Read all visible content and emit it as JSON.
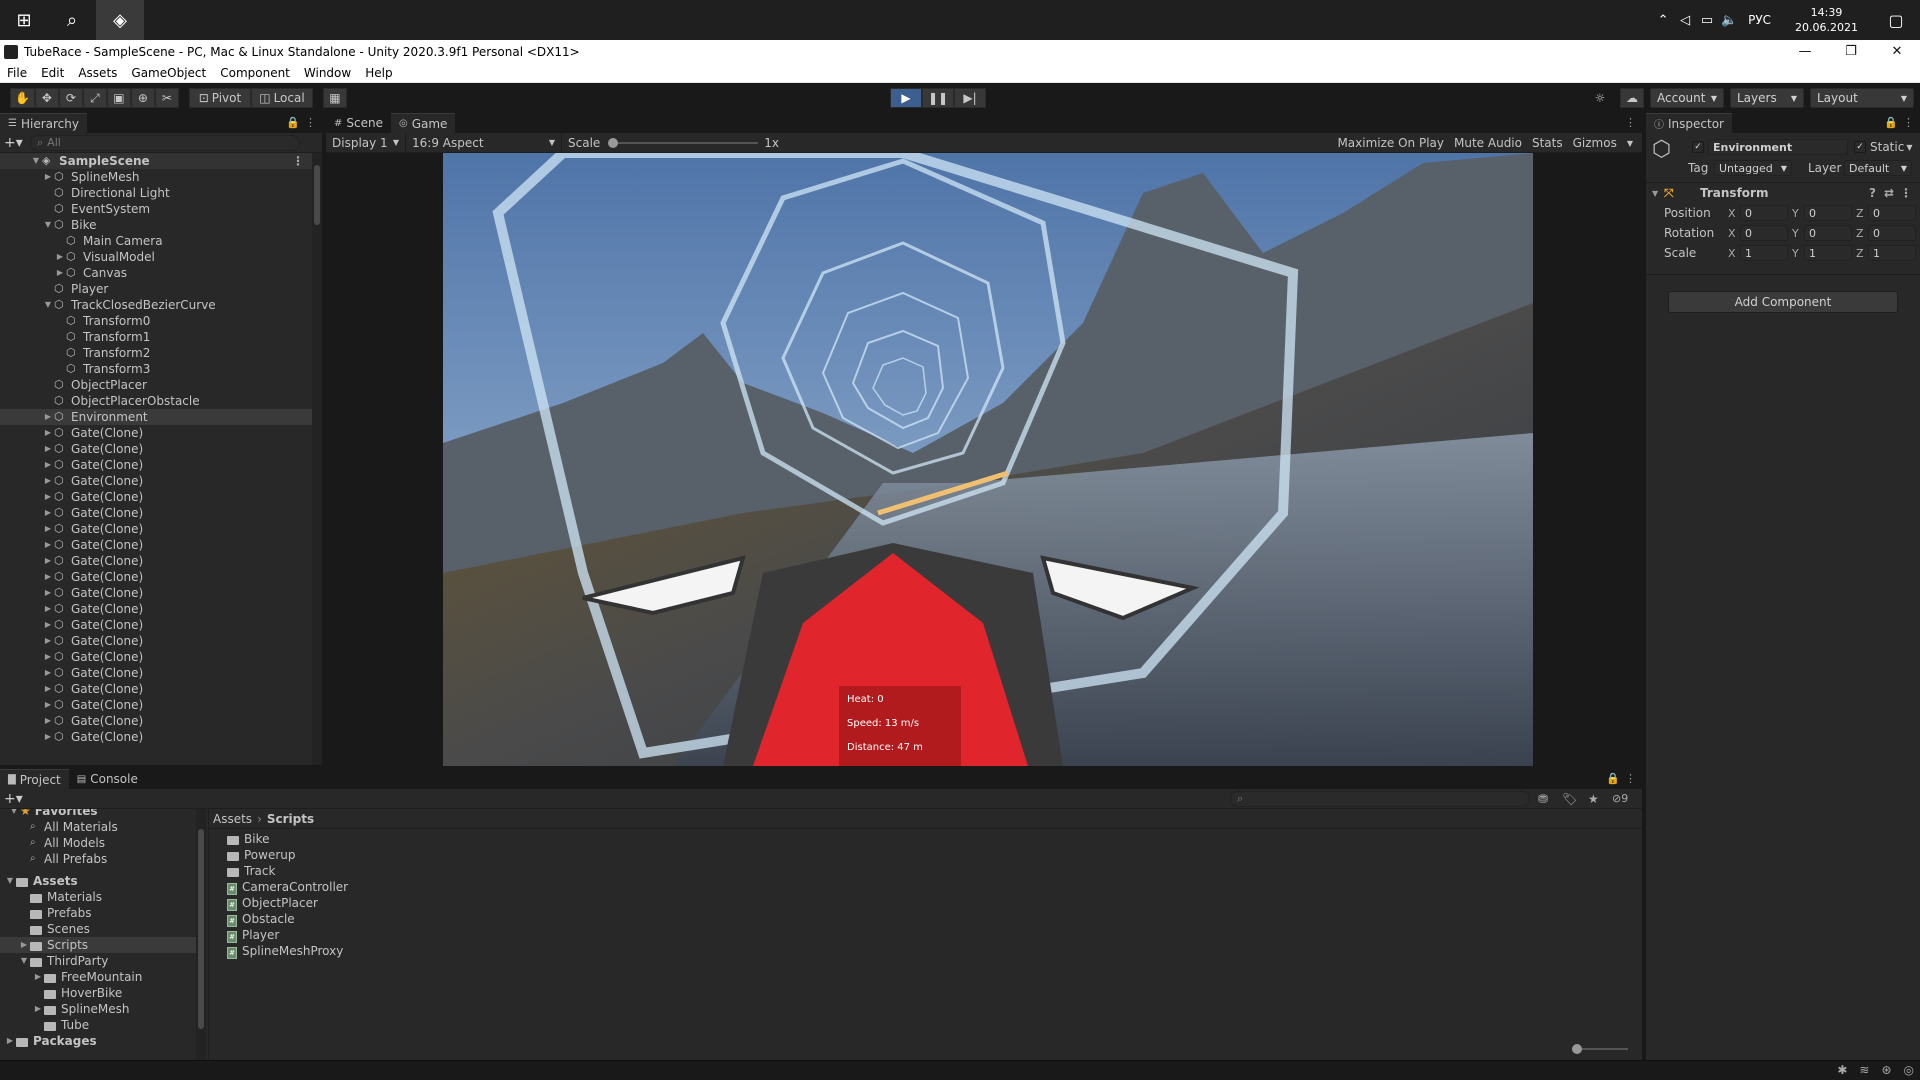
{
  "taskbar": {
    "tray": {
      "lang": "РУС",
      "time": "14:39",
      "date": "20.06.2021"
    }
  },
  "window": {
    "title": "TubeRace - SampleScene - PC, Mac & Linux Standalone - Unity 2020.3.9f1 Personal <DX11>"
  },
  "menu": [
    "File",
    "Edit",
    "Assets",
    "GameObject",
    "Component",
    "Window",
    "Help"
  ],
  "toolbar": {
    "pivot": "Pivot",
    "local": "Local",
    "account": "Account",
    "layers": "Layers",
    "layout": "Layout"
  },
  "hierarchy": {
    "tab": "Hierarchy",
    "search_placeholder": "All",
    "scene": "SampleScene",
    "items": [
      {
        "label": "SplineMesh",
        "depth": 1,
        "arrow": "▶"
      },
      {
        "label": "Directional Light",
        "depth": 1,
        "arrow": ""
      },
      {
        "label": "EventSystem",
        "depth": 1,
        "arrow": ""
      },
      {
        "label": "Bike",
        "depth": 1,
        "arrow": "▼"
      },
      {
        "label": "Main Camera",
        "depth": 2,
        "arrow": ""
      },
      {
        "label": "VisualModel",
        "depth": 2,
        "arrow": "▶"
      },
      {
        "label": "Canvas",
        "depth": 2,
        "arrow": "▶"
      },
      {
        "label": "Player",
        "depth": 1,
        "arrow": ""
      },
      {
        "label": "TrackClosedBezierCurve",
        "depth": 1,
        "arrow": "▼"
      },
      {
        "label": "Transform0",
        "depth": 2,
        "arrow": ""
      },
      {
        "label": "Transform1",
        "depth": 2,
        "arrow": ""
      },
      {
        "label": "Transform2",
        "depth": 2,
        "arrow": ""
      },
      {
        "label": "Transform3",
        "depth": 2,
        "arrow": ""
      },
      {
        "label": "ObjectPlacer",
        "depth": 1,
        "arrow": ""
      },
      {
        "label": "ObjectPlacerObstacle",
        "depth": 1,
        "arrow": ""
      },
      {
        "label": "Environment",
        "depth": 1,
        "arrow": "▶",
        "selected": true
      },
      {
        "label": "Gate(Clone)",
        "depth": 1,
        "arrow": "▶"
      },
      {
        "label": "Gate(Clone)",
        "depth": 1,
        "arrow": "▶"
      },
      {
        "label": "Gate(Clone)",
        "depth": 1,
        "arrow": "▶"
      },
      {
        "label": "Gate(Clone)",
        "depth": 1,
        "arrow": "▶"
      },
      {
        "label": "Gate(Clone)",
        "depth": 1,
        "arrow": "▶"
      },
      {
        "label": "Gate(Clone)",
        "depth": 1,
        "arrow": "▶"
      },
      {
        "label": "Gate(Clone)",
        "depth": 1,
        "arrow": "▶"
      },
      {
        "label": "Gate(Clone)",
        "depth": 1,
        "arrow": "▶"
      },
      {
        "label": "Gate(Clone)",
        "depth": 1,
        "arrow": "▶"
      },
      {
        "label": "Gate(Clone)",
        "depth": 1,
        "arrow": "▶"
      },
      {
        "label": "Gate(Clone)",
        "depth": 1,
        "arrow": "▶"
      },
      {
        "label": "Gate(Clone)",
        "depth": 1,
        "arrow": "▶"
      },
      {
        "label": "Gate(Clone)",
        "depth": 1,
        "arrow": "▶"
      },
      {
        "label": "Gate(Clone)",
        "depth": 1,
        "arrow": "▶"
      },
      {
        "label": "Gate(Clone)",
        "depth": 1,
        "arrow": "▶"
      },
      {
        "label": "Gate(Clone)",
        "depth": 1,
        "arrow": "▶"
      },
      {
        "label": "Gate(Clone)",
        "depth": 1,
        "arrow": "▶"
      },
      {
        "label": "Gate(Clone)",
        "depth": 1,
        "arrow": "▶"
      },
      {
        "label": "Gate(Clone)",
        "depth": 1,
        "arrow": "▶"
      },
      {
        "label": "Gate(Clone)",
        "depth": 1,
        "arrow": "▶"
      }
    ]
  },
  "game": {
    "tabs": [
      "Scene",
      "Game"
    ],
    "display": "Display 1",
    "aspect": "16:9 Aspect",
    "scale_label": "Scale",
    "scale_value": "1x",
    "maximize": "Maximize On Play",
    "mute": "Mute Audio",
    "stats": "Stats",
    "gizmos": "Gizmos",
    "hud": {
      "heat": "Heat: 0",
      "speed": "Speed: 13 m/s",
      "distance": "Distance: 47 m"
    }
  },
  "inspector": {
    "tab": "Inspector",
    "object_name": "Environment",
    "static": "Static",
    "tag_label": "Tag",
    "tag_value": "Untagged",
    "layer_label": "Layer",
    "layer_value": "Default",
    "component": "Transform",
    "rows": [
      {
        "label": "Position",
        "x": "0",
        "y": "0",
        "z": "0"
      },
      {
        "label": "Rotation",
        "x": "0",
        "y": "0",
        "z": "0"
      },
      {
        "label": "Scale",
        "x": "1",
        "y": "1",
        "z": "1"
      }
    ],
    "add_component": "Add Component"
  },
  "project": {
    "tabs": [
      "Project",
      "Console"
    ],
    "hidden_count": "9",
    "favorites": "Favorites",
    "fav_items": [
      "All Materials",
      "All Models",
      "All Prefabs"
    ],
    "tree": [
      {
        "label": "Assets",
        "depth": 0,
        "arrow": "▼",
        "bold": true
      },
      {
        "label": "Materials",
        "depth": 1,
        "arrow": ""
      },
      {
        "label": "Prefabs",
        "depth": 1,
        "arrow": ""
      },
      {
        "label": "Scenes",
        "depth": 1,
        "arrow": ""
      },
      {
        "label": "Scripts",
        "depth": 1,
        "arrow": "▶",
        "selected": true
      },
      {
        "label": "ThirdParty",
        "depth": 1,
        "arrow": "▼"
      },
      {
        "label": "FreeMountain",
        "depth": 2,
        "arrow": "▶"
      },
      {
        "label": "HoverBike",
        "depth": 2,
        "arrow": ""
      },
      {
        "label": "SplineMesh",
        "depth": 2,
        "arrow": "▶"
      },
      {
        "label": "Tube",
        "depth": 2,
        "arrow": ""
      },
      {
        "label": "Packages",
        "depth": 0,
        "arrow": "▶",
        "bold": true
      }
    ],
    "breadcrumb": [
      "Assets",
      "Scripts"
    ],
    "files": [
      {
        "label": "Bike",
        "kind": "folder"
      },
      {
        "label": "Powerup",
        "kind": "folder"
      },
      {
        "label": "Track",
        "kind": "folder"
      },
      {
        "label": "CameraController",
        "kind": "script"
      },
      {
        "label": "ObjectPlacer",
        "kind": "script"
      },
      {
        "label": "Obstacle",
        "kind": "script"
      },
      {
        "label": "Player",
        "kind": "script"
      },
      {
        "label": "SplineMeshProxy",
        "kind": "script"
      }
    ]
  },
  "colors": {
    "accent_play": "#3d5f8f",
    "panel_bg": "#282828",
    "dark_bg": "#191919",
    "hud_red": "#e0252c"
  }
}
